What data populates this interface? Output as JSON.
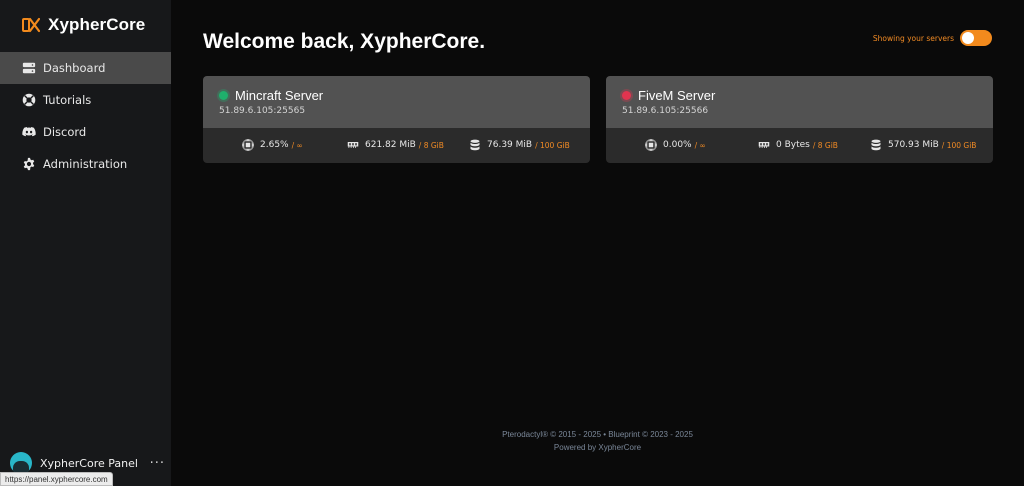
{
  "brand": {
    "name": "XypherCore",
    "logo_icon": "xc-logo-icon",
    "accent": "#f28a1d"
  },
  "nav": {
    "items": [
      {
        "label": "Dashboard",
        "icon": "server-stack-icon",
        "active": true
      },
      {
        "label": "Tutorials",
        "icon": "lifebuoy-icon",
        "active": false
      },
      {
        "label": "Discord",
        "icon": "discord-icon",
        "active": false
      },
      {
        "label": "Administration",
        "icon": "gear-icon",
        "active": false
      }
    ]
  },
  "header": {
    "welcome": "Welcome back, XypherCore.",
    "toggle_label": "Showing your servers",
    "toggle_on": true
  },
  "servers": [
    {
      "name": "Mincraft Server",
      "address": "51.89.6.105:25565",
      "status_color": "#1fb06c",
      "cpu": "2.65%",
      "cpu_limit": "/ ∞",
      "memory": "621.82 MiB",
      "memory_limit": "/ 8 GiB",
      "disk": "76.39 MiB",
      "disk_limit": "/ 100 GiB"
    },
    {
      "name": "FiveM Server",
      "address": "51.89.6.105:25566",
      "status_color": "#e2344f",
      "cpu": "0.00%",
      "cpu_limit": "/ ∞",
      "memory": "0 Bytes",
      "memory_limit": "/ 8 GiB",
      "disk": "570.93 MiB",
      "disk_limit": "/ 100 GiB"
    }
  ],
  "account": {
    "name": "XypherCore Panel",
    "more_label": "···"
  },
  "footer": {
    "line1": "Pterodactyl® © 2015 - 2025  •  Blueprint © 2023 - 2025",
    "line2": "Powered by XypherCore"
  },
  "status_bar_url": "https://panel.xyphercore.com"
}
